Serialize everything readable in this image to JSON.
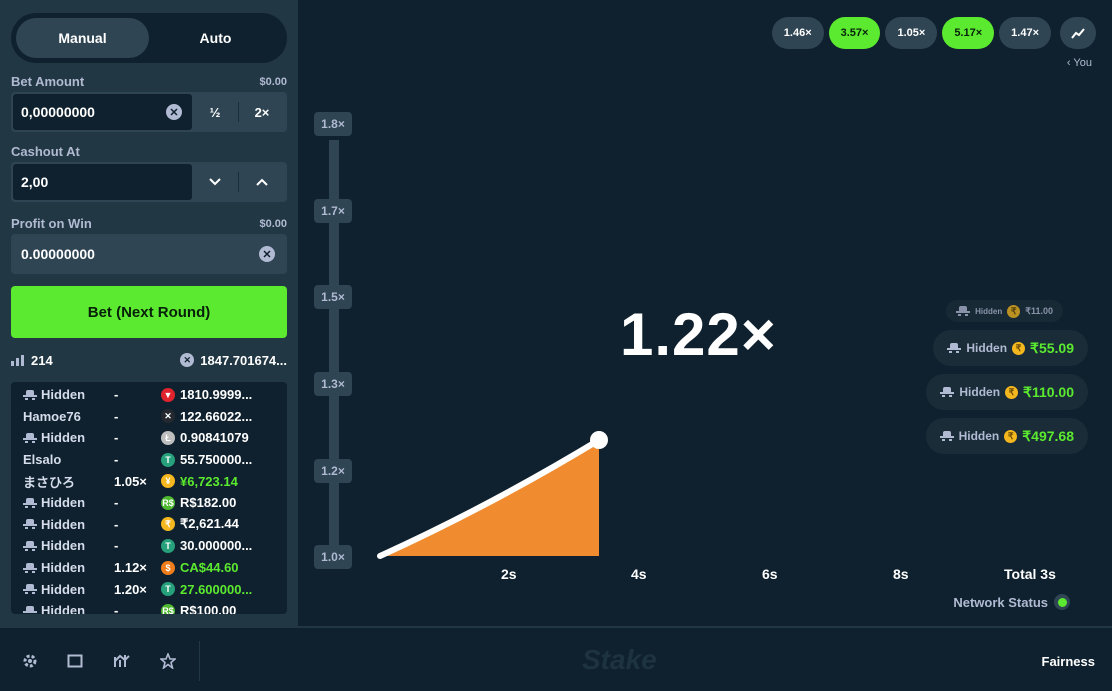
{
  "mode_tabs": {
    "manual": "Manual",
    "auto": "Auto"
  },
  "bet_amount": {
    "label": "Bet Amount",
    "usd": "$0.00",
    "value": "0,00000000",
    "half_label": "½",
    "double_label": "2×"
  },
  "cashout": {
    "label": "Cashout At",
    "value": "2,00"
  },
  "profit": {
    "label": "Profit on Win",
    "usd": "$0.00",
    "value": "0.00000000"
  },
  "bet_button": "Bet (Next Round)",
  "stats": {
    "players": "214",
    "total": "1847.701674..."
  },
  "players": [
    {
      "name": "Hidden",
      "hidden": true,
      "multiplier": "-",
      "currency": "TRX",
      "cur_color": "#e0232c",
      "cur_glyph": "▼",
      "amount": "1810.9999...",
      "win": false
    },
    {
      "name": "Hamoe76",
      "hidden": false,
      "multiplier": "-",
      "currency": "XRP",
      "cur_color": "#23292f",
      "cur_glyph": "✕",
      "amount": "122.66022...",
      "win": false
    },
    {
      "name": "Hidden",
      "hidden": true,
      "multiplier": "-",
      "currency": "LTC",
      "cur_color": "#bebebe",
      "cur_glyph": "Ł",
      "amount": "0.90841079",
      "win": false
    },
    {
      "name": "Elsalo",
      "hidden": false,
      "multiplier": "-",
      "currency": "USDT",
      "cur_color": "#26a17b",
      "cur_glyph": "T",
      "amount": "55.750000...",
      "win": false
    },
    {
      "name": "まさひろ",
      "hidden": false,
      "multiplier": "1.05×",
      "currency": "JPY",
      "cur_color": "#f5b71e",
      "cur_glyph": "¥",
      "amount": "¥6,723.14",
      "win": true
    },
    {
      "name": "Hidden",
      "hidden": true,
      "multiplier": "-",
      "currency": "BRL",
      "cur_color": "#4cb72f",
      "cur_glyph": "R$",
      "amount": "R$182.00",
      "win": false
    },
    {
      "name": "Hidden",
      "hidden": true,
      "multiplier": "-",
      "currency": "INR",
      "cur_color": "#f5b71e",
      "cur_glyph": "₹",
      "amount": "₹2,621.44",
      "win": false
    },
    {
      "name": "Hidden",
      "hidden": true,
      "multiplier": "-",
      "currency": "USDT",
      "cur_color": "#26a17b",
      "cur_glyph": "T",
      "amount": "30.000000...",
      "win": false
    },
    {
      "name": "Hidden",
      "hidden": true,
      "multiplier": "1.12×",
      "currency": "CAD",
      "cur_color": "#f07d1c",
      "cur_glyph": "$",
      "amount": "CA$44.60",
      "win": true
    },
    {
      "name": "Hidden",
      "hidden": true,
      "multiplier": "1.20×",
      "currency": "USDT",
      "cur_color": "#26a17b",
      "cur_glyph": "T",
      "amount": "27.600000...",
      "win": true
    },
    {
      "name": "Hidden",
      "hidden": true,
      "multiplier": "-",
      "currency": "BRL",
      "cur_color": "#4cb72f",
      "cur_glyph": "R$",
      "amount": "R$100.00",
      "win": false
    }
  ],
  "history": [
    "1.46×",
    "3.57×",
    "1.05×",
    "5.17×",
    "1.47×"
  ],
  "history_green": [
    false,
    true,
    false,
    true,
    false
  ],
  "you_label": "‹ You",
  "multiplier": "1.22×",
  "y_ticks": [
    "1.8×",
    "1.7×",
    "1.5×",
    "1.3×",
    "1.2×",
    "1.0×"
  ],
  "x_ticks": [
    "2s",
    "4s",
    "6s",
    "8s"
  ],
  "total_time": "Total 3s",
  "cashouts": [
    {
      "name": "Hidden",
      "amount": "₹11.00",
      "faded": true
    },
    {
      "name": "Hidden",
      "amount": "₹55.09",
      "faded": false
    },
    {
      "name": "Hidden",
      "amount": "₹110.00",
      "faded": false
    },
    {
      "name": "Hidden",
      "amount": "₹497.68",
      "faded": false
    }
  ],
  "network_status": "Network Status",
  "footer": {
    "logo": "Stake",
    "fairness": "Fairness"
  },
  "colors": {
    "accent": "#5bea2f",
    "fill": "#f08c2f",
    "panel": "#213743",
    "bg": "#0f212e"
  }
}
